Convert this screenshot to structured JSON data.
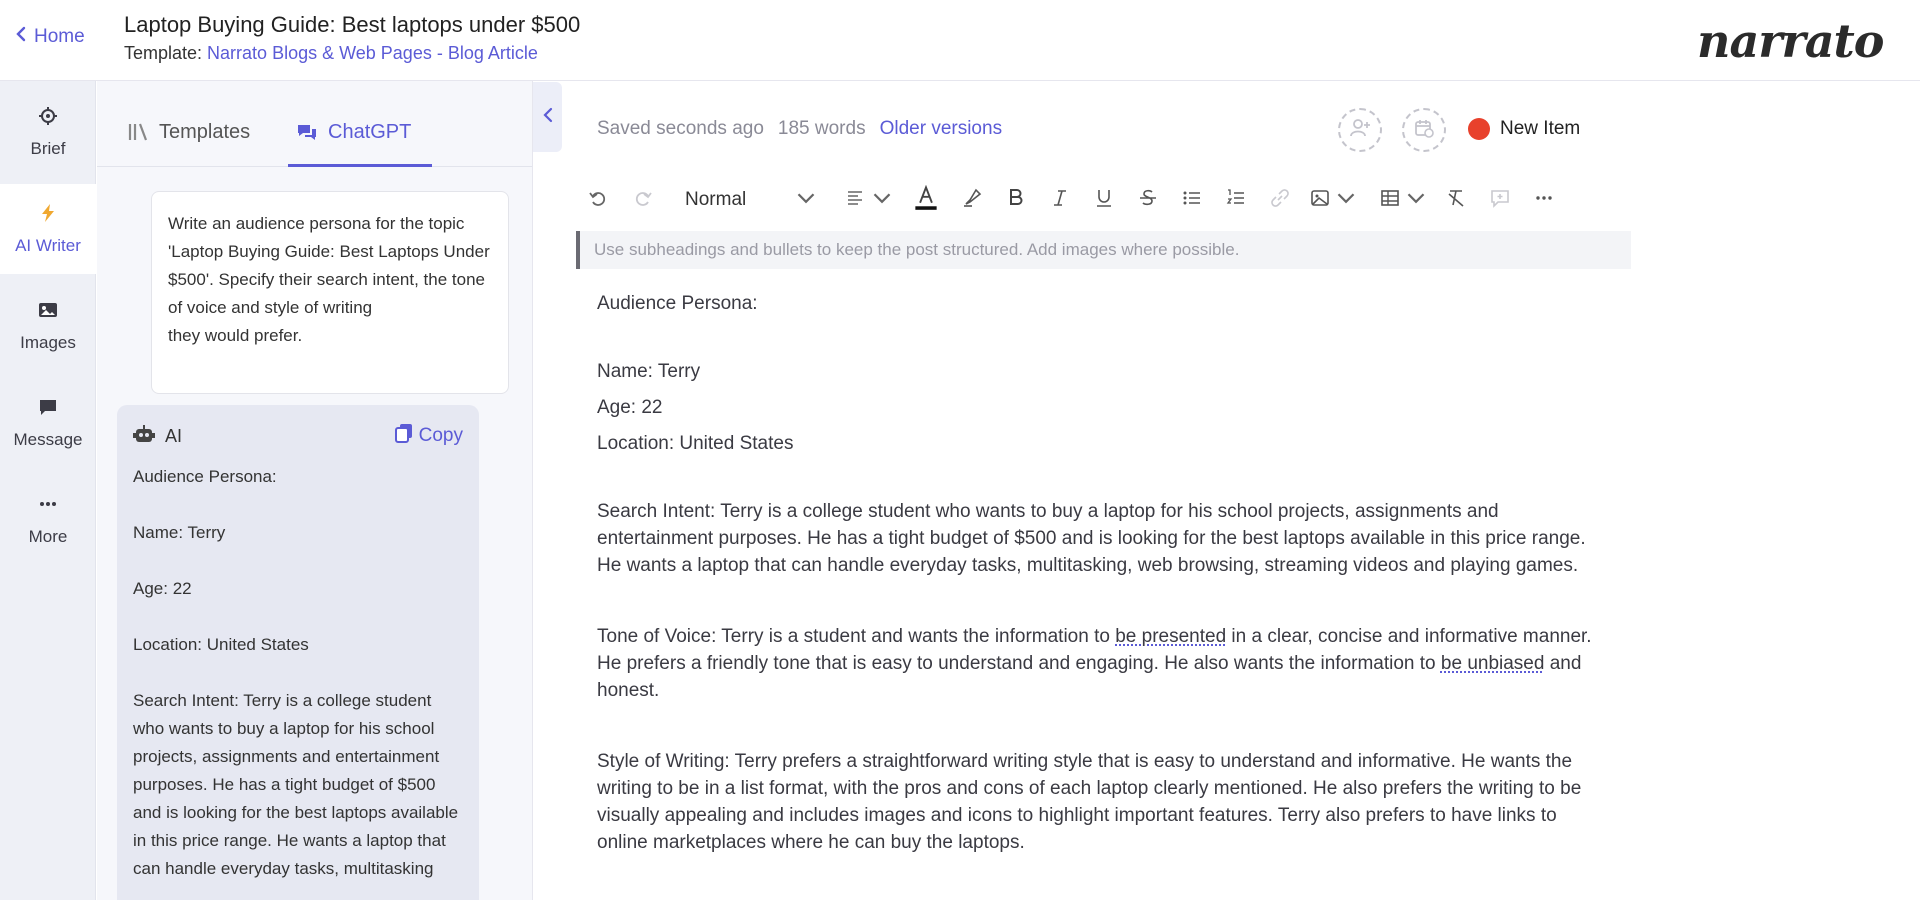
{
  "header": {
    "home_label": "Home",
    "title": "Laptop Buying Guide: Best laptops under $500",
    "template_prefix": "Template: ",
    "template_name": "Narrato Blogs & Web Pages - Blog Article",
    "logo": "narrato"
  },
  "rail": {
    "items": [
      {
        "label": "Brief",
        "icon": "crosshair-icon"
      },
      {
        "label": "AI Writer",
        "icon": "lightning-icon"
      },
      {
        "label": "Images",
        "icon": "image-icon"
      },
      {
        "label": "Message",
        "icon": "chat-bubble-icon"
      },
      {
        "label": "More",
        "icon": "ellipsis-icon"
      }
    ]
  },
  "panel": {
    "tabs": [
      {
        "label": "Templates",
        "icon": "templates-icon"
      },
      {
        "label": "ChatGPT",
        "icon": "chat-icon"
      }
    ],
    "prompt": "Write an audience persona for the topic 'Laptop Buying Guide: Best Laptops Under $500'. Specify their search intent, the tone of voice and style of writing\n they would prefer.",
    "ai_label": "AI",
    "copy_label": "Copy",
    "ai_response": {
      "p1": "Audience Persona:",
      "p2": "Name: Terry",
      "p3": "Age: 22",
      "p4": "Location: United States",
      "p5": "Search Intent: Terry is a college student who wants to buy a laptop for his school projects, assignments and entertainment purposes. He has a tight budget of $500 and is looking for the best laptops available in this price range. He wants a laptop that can handle everyday tasks, multitasking"
    }
  },
  "editor": {
    "saved": "Saved seconds ago",
    "words": "185 words",
    "older_versions": "Older versions",
    "status": "New Item",
    "status_color": "#e8412c",
    "format_value": "Normal",
    "hint": "Use subheadings and bullets to keep the post structured. Add images where possible.",
    "content": {
      "heading": "Audience Persona:",
      "name": "Name: Terry",
      "age": "Age: 22",
      "location": "Location: United States",
      "search_intent": "Search Intent: Terry is a college student who wants to buy a laptop for his school projects, assignments and entertainment purposes. He has a tight budget of $500 and is looking for the best laptops available in this price range. He wants a laptop that can handle everyday tasks, multitasking, web browsing, streaming videos and playing games.",
      "tone_a": "Tone of Voice: Terry is a student and wants the information to ",
      "tone_b": "be presented",
      "tone_c": " in a clear, concise and informative manner. He prefers a friendly tone that is easy to understand and engaging. He also wants the information to ",
      "tone_d": "be unbiased",
      "tone_e": " and honest.",
      "style": "Style of Writing: Terry prefers a straightforward writing style that is easy to understand and informative. He wants the writing to be in a list format, with the pros and cons of each laptop clearly mentioned. He also prefers the writing to be visually appealing and includes images and icons to highlight important features. Terry also prefers to have links to online marketplaces where he can buy the laptops."
    }
  },
  "accent_color": "#5b5bd6"
}
